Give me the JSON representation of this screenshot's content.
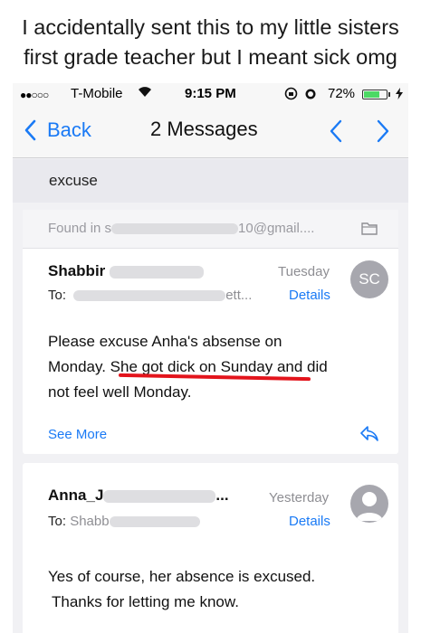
{
  "caption": {
    "line1": "I accidentally sent this to my little sisters",
    "line2": "first grade teacher but I meant sick omg"
  },
  "status_bar": {
    "signal": "●●○○○",
    "carrier": "T-Mobile",
    "time": "9:15 PM",
    "battery": "72%",
    "battery_level": 0.72
  },
  "nav": {
    "back_label": "Back",
    "title": "2 Messages"
  },
  "subject": "excuse",
  "messages": [
    {
      "found_in_prefix": "Found in s",
      "found_in_suffix": "10@gmail....",
      "sender_visible": "Shabbir",
      "date": "Tuesday",
      "to_label": "To:",
      "to_suffix": "ett...",
      "details": "Details",
      "avatar_initials": "SC",
      "body_line1": "Please excuse Anha's absense on",
      "body_line2": "Monday. She got dick on Sunday and did",
      "body_line3": "not feel well Monday.",
      "see_more": "See More"
    },
    {
      "sender_visible": "Anna_J",
      "sender_suffix": "...",
      "date": "Yesterday",
      "to_label": "To:",
      "to_visible": "Shabb",
      "details": "Details",
      "body_line1": "Yes of course, her absence is excused.",
      "body_line2": "Thanks for letting me know."
    }
  ],
  "colors": {
    "accent": "#1a7af5",
    "highlight": "#e3141c",
    "battery": "#4cd964"
  }
}
